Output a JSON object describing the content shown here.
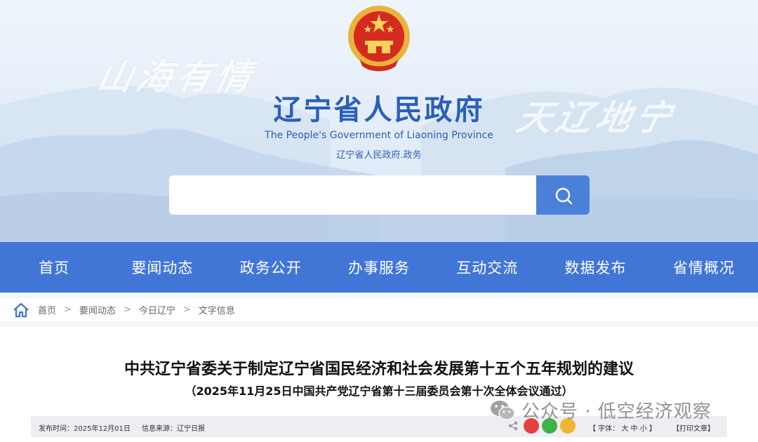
{
  "header": {
    "calligraphy_left": "山海有情",
    "calligraphy_right": "天辽地宁",
    "site_title": "辽宁省人民政府",
    "site_subtitle": "The People's Government of Liaoning Province",
    "site_domain": "辽宁省人民政府.政务",
    "search_placeholder": ""
  },
  "nav": {
    "items": [
      "首页",
      "要闻动态",
      "政务公开",
      "办事服务",
      "互动交流",
      "数据发布",
      "省情概况"
    ]
  },
  "breadcrumb": {
    "items": [
      "首页",
      "要闻动态",
      "今日辽宁",
      "文字信息"
    ],
    "separator": ">"
  },
  "article": {
    "title": "中共辽宁省委关于制定辽宁省国民经济和社会发展第十五个五年规划的建议",
    "subtitle": "（2025年11月25日中国共产党辽宁省第十三届委员会第十次全体会议通过）",
    "publish_date": "发布时间：2025年12月01日",
    "source": "信息来源：辽宁日报",
    "font_size_control": "【 字体： 大 中 小 】",
    "print_label": "【打印文章】"
  },
  "watermark": {
    "text": "公众号 · 低空经济观察"
  },
  "colors": {
    "nav_bg": "#4276d6",
    "title_blue": "#2b5fb8",
    "search_button": "#4b80d8"
  }
}
